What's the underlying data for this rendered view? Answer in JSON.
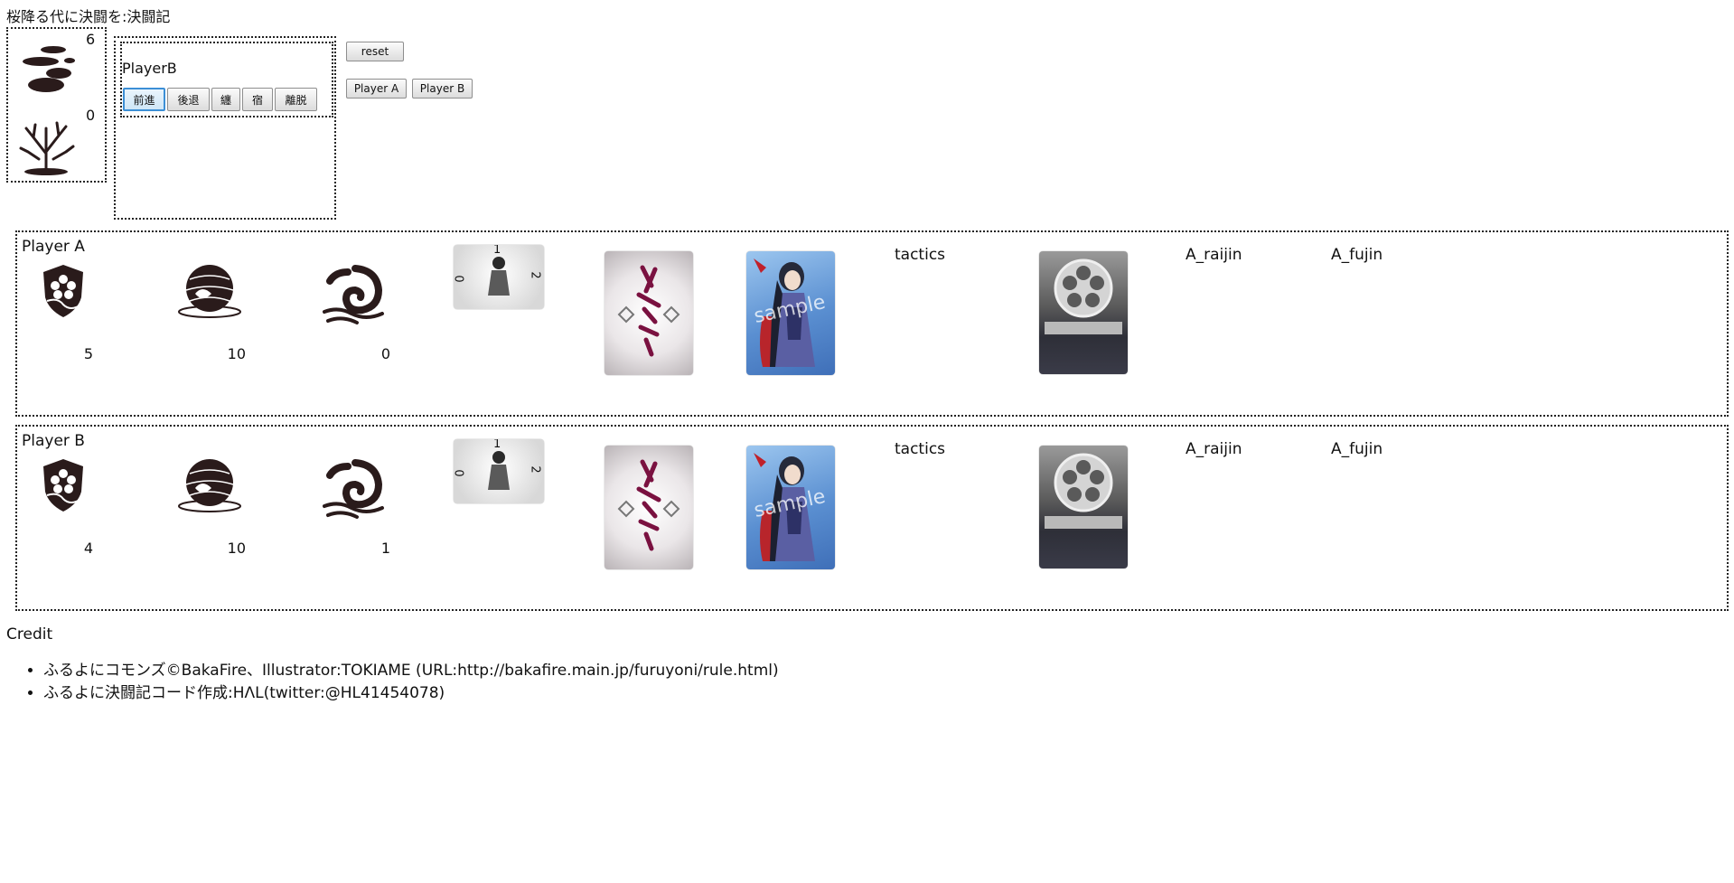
{
  "page": {
    "title": "桜降る代に決闘を:決闘記"
  },
  "pool": {
    "aura_value": "6",
    "life_value": "0"
  },
  "action_panel": {
    "player_label": "PlayerB",
    "buttons": [
      "前進",
      "後退",
      "纏",
      "宿",
      "離脱"
    ],
    "active_index": 0
  },
  "controls": {
    "reset": "reset",
    "player_a": "Player A",
    "player_b": "Player B"
  },
  "boards": [
    {
      "label": "Player A",
      "aura": "5",
      "life": "10",
      "flare": "0",
      "dial": [
        "1",
        "2",
        "0"
      ],
      "sample_watermark": "sample",
      "tactics": "tactics",
      "goddess_1": "A_raijin",
      "goddess_2": "A_fujin"
    },
    {
      "label": "Player B",
      "aura": "4",
      "life": "10",
      "flare": "1",
      "dial": [
        "1",
        "2",
        "0"
      ],
      "sample_watermark": "sample",
      "tactics": "tactics",
      "goddess_1": "A_raijin",
      "goddess_2": "A_fujin"
    }
  ],
  "credits": {
    "title": "Credit",
    "items": [
      "ふるよにコモンズ©BakaFire、Illustrator:TOKIAME (URL:http://bakafire.main.jp/furuyoni/rule.html)",
      "ふるよに決闘記コード作成:HΛL(twitter:@HL41454078)"
    ]
  },
  "icons": {
    "aura": "aura-shield-icon",
    "life": "life-sphere-icon",
    "flare": "flare-swirl-icon",
    "dust": "dust-cloud-icon",
    "distance": "bare-tree-icon"
  }
}
